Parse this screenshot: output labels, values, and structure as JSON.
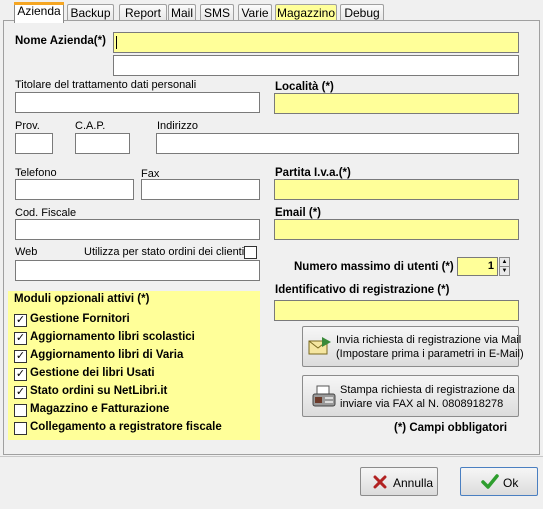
{
  "tabs": [
    {
      "label": "Azienda",
      "active": true
    },
    {
      "label": "Backup"
    },
    {
      "label": "Report"
    },
    {
      "label": "Mail"
    },
    {
      "label": "SMS"
    },
    {
      "label": "Varie"
    },
    {
      "label": "Magazzino",
      "highlight": "#ffff99"
    },
    {
      "label": "Debug"
    }
  ],
  "form": {
    "nome_azienda_label": "Nome Azienda(*)",
    "nome_azienda_value": "",
    "nome_azienda_2_value": "",
    "titolare_label": "Titolare del trattamento dati personali",
    "titolare_value": "",
    "localita_label": "Località (*)",
    "localita_value": "",
    "prov_label": "Prov.",
    "cap_label": "C.A.P.",
    "indirizzo_label": "Indirizzo",
    "telefono_label": "Telefono",
    "fax_label": "Fax",
    "partita_iva_label": "Partita I.v.a.(*)",
    "cod_fiscale_label": "Cod. Fiscale",
    "email_label": "Email (*)",
    "web_label": "Web",
    "stato_ordini_label": "Utilizza per stato ordini dei clienti",
    "stato_ordini_checked": false,
    "num_utenti_label": "Numero massimo di utenti (*)",
    "num_utenti_value": "1",
    "identificativo_label": "Identificativo di registrazione (*)",
    "identificativo_value": ""
  },
  "modules": {
    "title": "Moduli opzionali attivi (*)",
    "items": [
      {
        "label": "Gestione Fornitori",
        "checked": true
      },
      {
        "label": "Aggiornamento libri scolastici",
        "checked": true
      },
      {
        "label": "Aggiornamento libri di Varia",
        "checked": true
      },
      {
        "label": "Gestione dei libri Usati",
        "checked": true
      },
      {
        "label": "Stato ordini su NetLibri.it",
        "checked": true
      },
      {
        "label": "Magazzino e Fatturazione",
        "checked": false
      },
      {
        "label": "Collegamento a registratore fiscale",
        "checked": false
      }
    ]
  },
  "actions": {
    "mail_line1": "Invia richiesta di registrazione via Mail",
    "mail_line2": "(Impostare prima i parametri in E-Mail)",
    "fax_line1": "Stampa richiesta di registrazione da",
    "fax_line2": "inviare via FAX al N. 0808918278",
    "required_note": "(*) Campi obbligatori"
  },
  "footer": {
    "cancel_label": "Annulla",
    "ok_label": "Ok"
  },
  "colors": {
    "required_field": "#ffff99",
    "cancel_icon": "#b22222",
    "ok_icon": "#2e9e2e"
  }
}
